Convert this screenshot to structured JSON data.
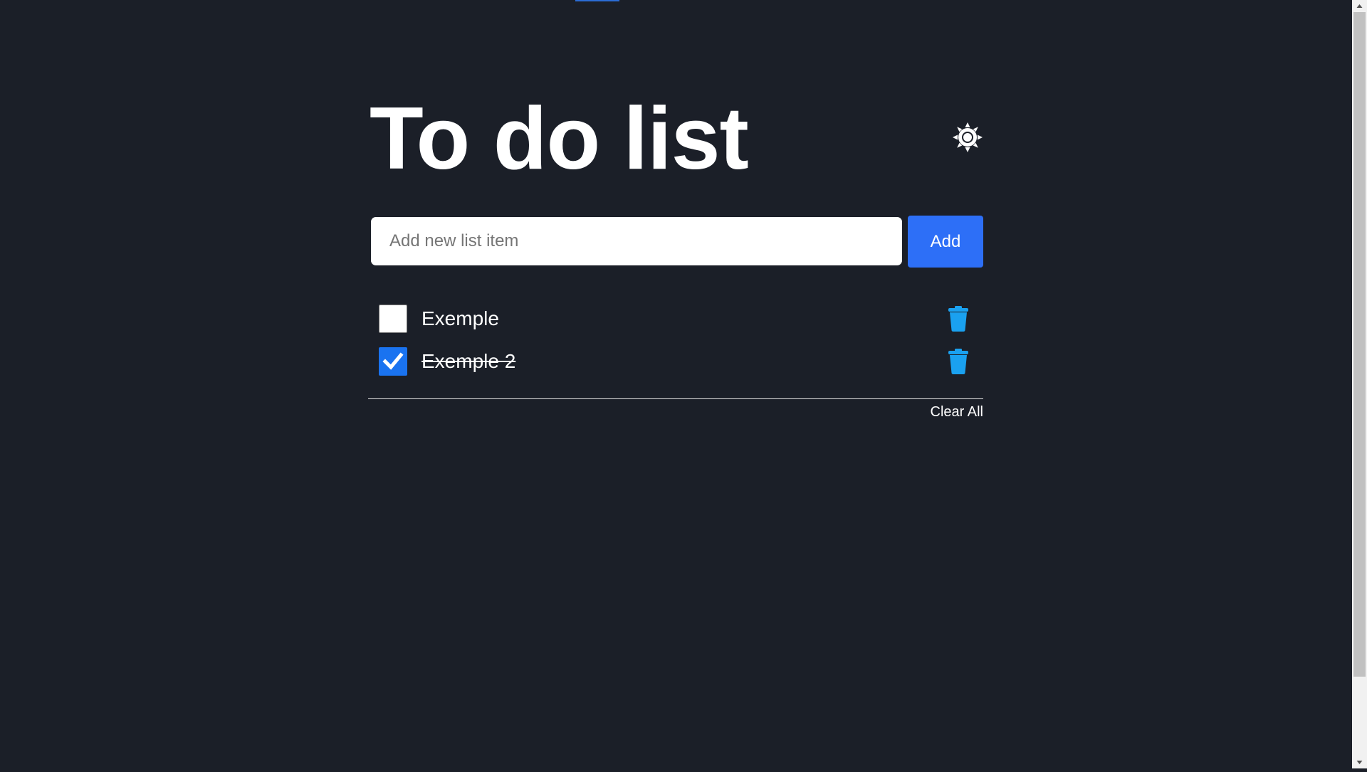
{
  "header": {
    "title": "To do list",
    "theme_toggle_icon": "sun-icon"
  },
  "form": {
    "input_value": "",
    "input_placeholder": "Add new list item",
    "add_label": "Add"
  },
  "items": [
    {
      "text": "Exemple",
      "checked": false,
      "delete_icon": "trash-icon"
    },
    {
      "text": "Exemple 2",
      "checked": true,
      "delete_icon": "trash-icon"
    }
  ],
  "footer": {
    "clear_label": "Clear All"
  },
  "colors": {
    "background": "#1b1f28",
    "accent": "#2d6ff7",
    "checkbox_checked": "#1a73f0",
    "trash": "#1aa1f0",
    "text": "#ffffff"
  }
}
